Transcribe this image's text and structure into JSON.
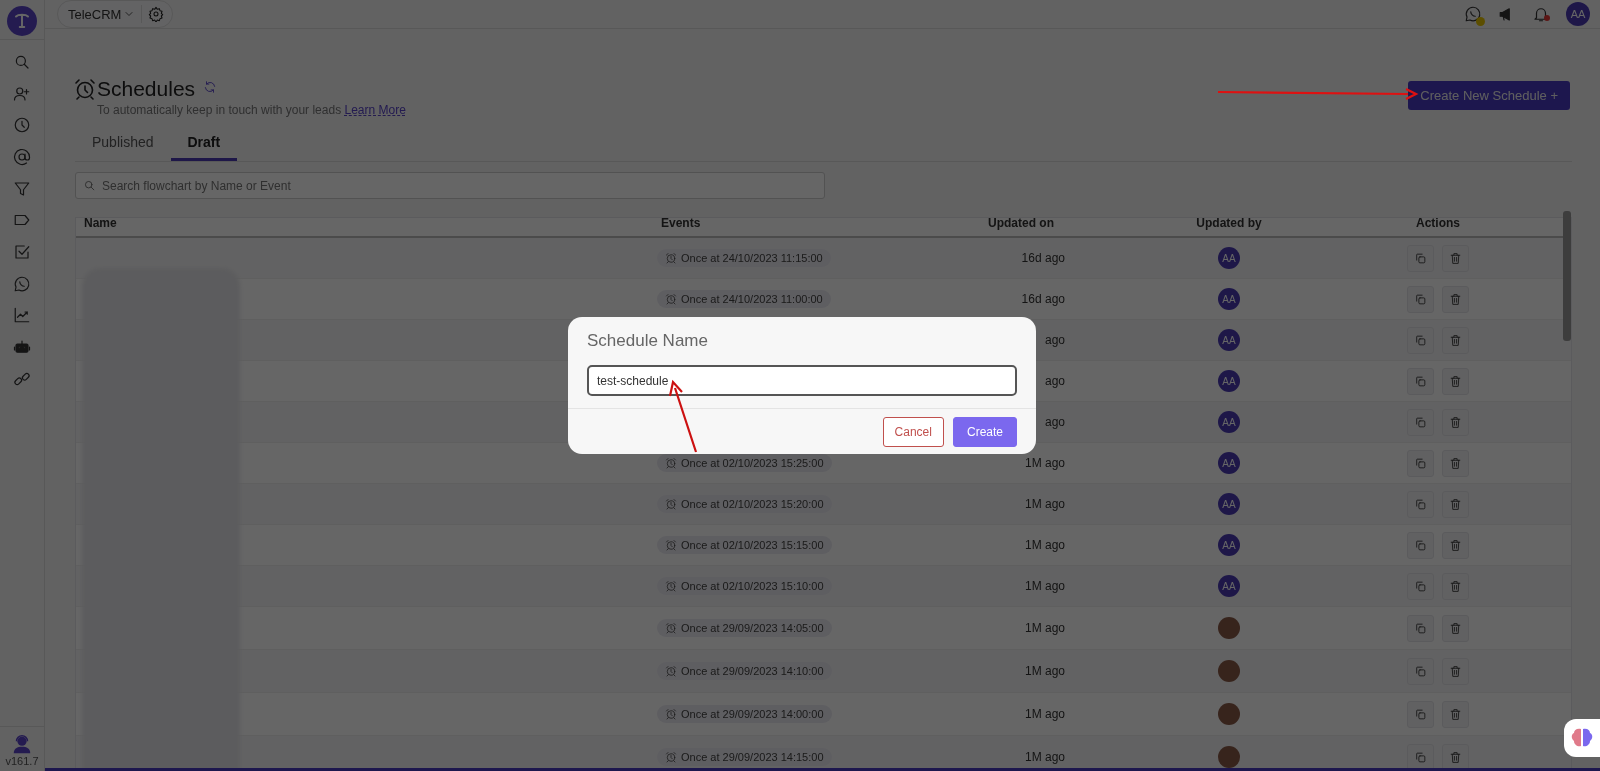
{
  "topbar": {
    "workspace": "TeleCRM",
    "user_initials": "AA"
  },
  "sidebar": {
    "version": "v161.7"
  },
  "header": {
    "title": "Schedules",
    "subtitle": "To automatically keep in touch with your leads",
    "link": "Learn More",
    "create_button": "Create New Schedule +"
  },
  "tabs": [
    {
      "label": "Published",
      "selected": false
    },
    {
      "label": "Draft",
      "selected": true
    }
  ],
  "search": {
    "placeholder": "Search flowchart by Name or Event"
  },
  "table": {
    "columns": [
      "Name",
      "Events",
      "Updated on",
      "Updated by",
      "Actions"
    ],
    "rows": [
      {
        "event": "Once at 24/10/2023 11:15:00",
        "updated_on": "16d ago",
        "updated_by": {
          "kind": "initials",
          "text": "AA"
        }
      },
      {
        "event": "Once at 24/10/2023 11:00:00",
        "updated_on": "16d ago",
        "updated_by": {
          "kind": "initials",
          "text": "AA"
        }
      },
      {
        "updated_on": "ago",
        "updated_by": {
          "kind": "initials",
          "text": "AA"
        }
      },
      {
        "updated_on": "ago",
        "updated_by": {
          "kind": "initials",
          "text": "AA"
        }
      },
      {
        "updated_on": "ago",
        "updated_by": {
          "kind": "initials",
          "text": "AA"
        }
      },
      {
        "event": "Once at 02/10/2023 15:25:00",
        "updated_on": "1M ago",
        "updated_by": {
          "kind": "initials",
          "text": "AA"
        }
      },
      {
        "event": "Once at 02/10/2023 15:20:00",
        "updated_on": "1M ago",
        "updated_by": {
          "kind": "initials",
          "text": "AA"
        }
      },
      {
        "event": "Once at 02/10/2023 15:15:00",
        "updated_on": "1M ago",
        "updated_by": {
          "kind": "initials",
          "text": "AA"
        }
      },
      {
        "event": "Once at 02/10/2023 15:10:00",
        "updated_on": "1M ago",
        "updated_by": {
          "kind": "initials",
          "text": "AA"
        }
      },
      {
        "event": "Once at 29/09/2023 14:05:00",
        "updated_on": "1M ago",
        "updated_by": {
          "kind": "photo"
        }
      },
      {
        "event": "Once at 29/09/2023 14:10:00",
        "updated_on": "1M ago",
        "updated_by": {
          "kind": "photo"
        }
      },
      {
        "event": "Once at 29/09/2023 14:00:00",
        "updated_on": "1M ago",
        "updated_by": {
          "kind": "photo"
        }
      },
      {
        "event": "Once at 29/09/2023 14:15:00",
        "updated_on": "1M ago",
        "updated_by": {
          "kind": "photo"
        }
      }
    ]
  },
  "modal": {
    "title": "Schedule Name",
    "value": "test-schedule",
    "buttons": [
      {
        "label": "Cancel",
        "kind": "secondary"
      },
      {
        "label": "Create",
        "kind": "primary"
      }
    ]
  },
  "annotations": [
    {
      "kind": "arrow"
    },
    {
      "kind": "arrow"
    }
  ]
}
